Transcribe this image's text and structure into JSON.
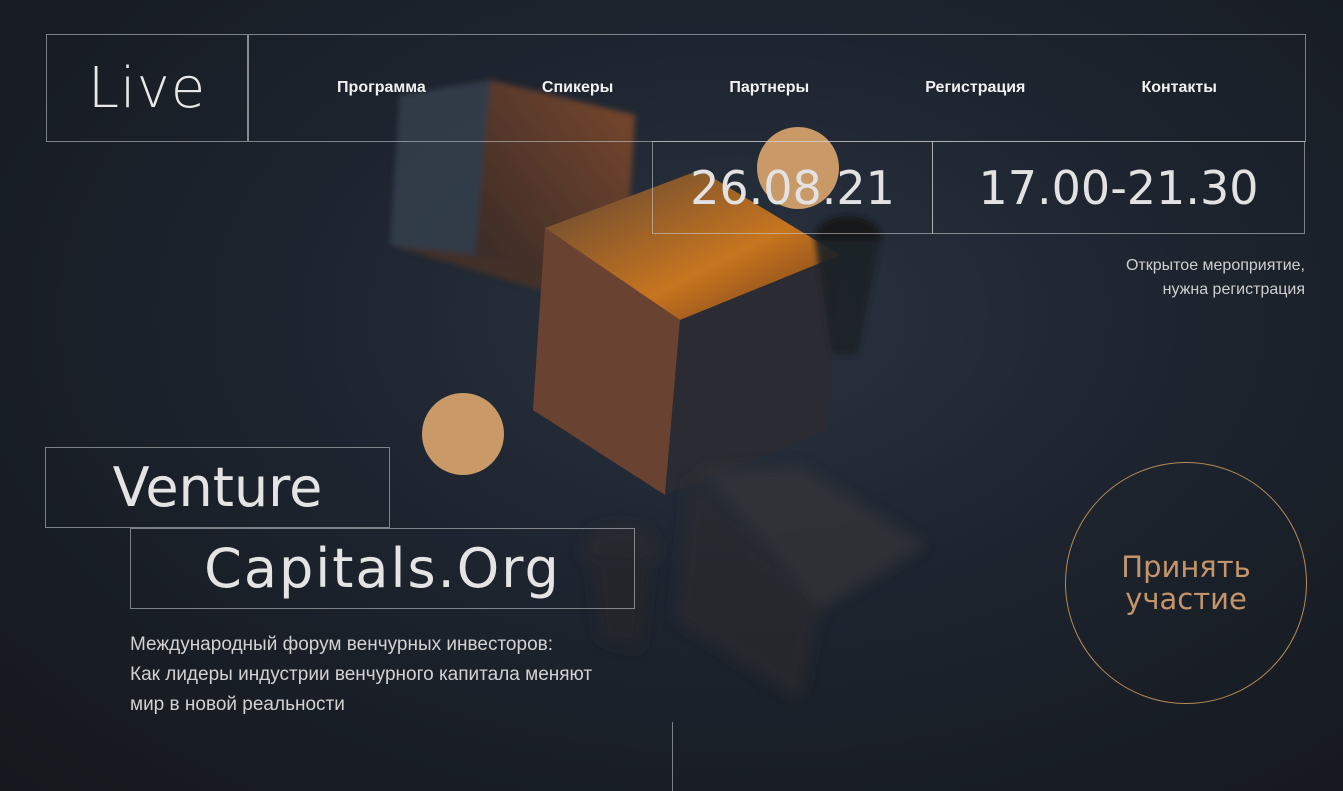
{
  "header": {
    "logo": "Live",
    "nav": [
      "Программа",
      "Спикеры",
      "Партнеры",
      "Регистрация",
      "Контакты"
    ]
  },
  "event": {
    "date": "26.08.21",
    "time": "17.00-21.30",
    "note_line1": "Открытое мероприятие,",
    "note_line2": "нужна регистрация"
  },
  "title": {
    "line1": "Venture",
    "line2": "Capitals.Org"
  },
  "description": [
    "Международный форум венчурных инвесторов:",
    "Как лидеры индустрии венчурного капитала меняют",
    "мир в новой реальности"
  ],
  "cta": {
    "line1": "Принять",
    "line2": "участие"
  },
  "colors": {
    "accent": "#c4956a",
    "orb": "#d4a06a",
    "background": "#1b2129"
  }
}
